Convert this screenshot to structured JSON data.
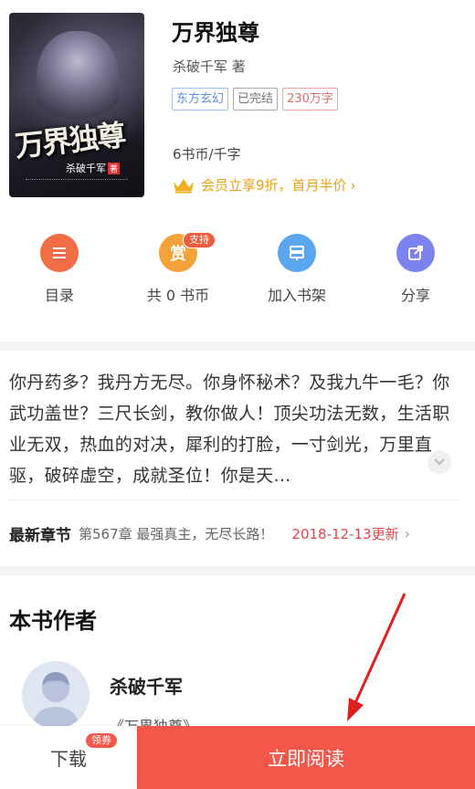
{
  "book": {
    "cover_title": "万界独尊",
    "cover_author": "杀破千军",
    "cover_author_suffix": "著",
    "title": "万界独尊",
    "author_line": "杀破千军 著",
    "tags": [
      "东方玄幻",
      "已完结",
      "230万字"
    ],
    "price": "6书币/千字",
    "vip_offer": "会员立享9折，首月半价"
  },
  "actions": [
    {
      "label": "目录",
      "icon": "list-icon"
    },
    {
      "label": "共 0 书币",
      "icon": "reward-icon",
      "badge": "支持"
    },
    {
      "label": "加入书架",
      "icon": "bookshelf-icon"
    },
    {
      "label": "分享",
      "icon": "share-icon"
    }
  ],
  "description": "你丹药多？我丹方无尽。你身怀秘术？及我九牛一毛？你武功盖世？三尺长剑，教你做人！顶尖功法无数，生活职业无双，热血的对决，犀利的打脸，一寸剑光，万里直驱，破碎虚空，成就圣位！你是天...",
  "latest": {
    "label": "最新章节",
    "chapter": "第567章 最强真主，无尽长路！",
    "date": "2018-12-13更新"
  },
  "author_section": {
    "heading": "本书作者",
    "name": "杀破千军",
    "book": "《万界独尊》"
  },
  "bottom": {
    "download": "下载",
    "coupon": "领券",
    "read": "立即阅读"
  },
  "colors": {
    "accent": "#f4564a",
    "vip": "#e8a118"
  }
}
